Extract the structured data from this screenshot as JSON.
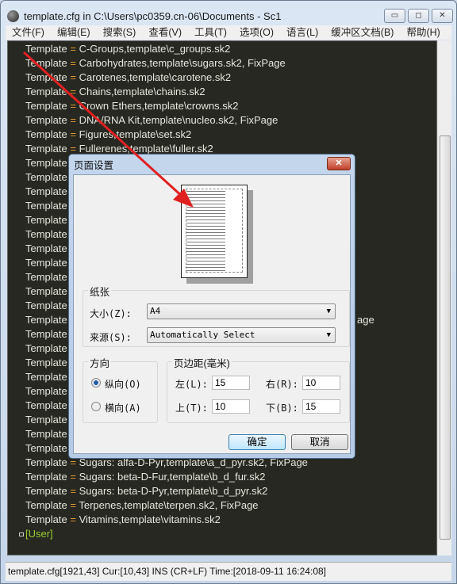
{
  "window": {
    "title": "template.cfg in C:\\Users\\pc0359.cn-06\\Documents - Sc1",
    "buttons": {
      "minimize": "▭",
      "maximize": "◻",
      "close": "✕"
    }
  },
  "menu": [
    "文件(F)",
    "编辑(E)",
    "搜索(S)",
    "查看(V)",
    "工具(T)",
    "选项(O)",
    "语言(L)",
    "缓冲区文档(B)",
    "帮助(H)"
  ],
  "editor": {
    "key": "Template",
    "eq": "=",
    "lines": [
      "C-Groups,template\\c_groups.sk2",
      "Carbohydrates,template\\sugars.sk2, FixPage",
      "Carotenes,template\\carotene.sk2",
      "Chains,template\\chains.sk2",
      "Crown Ethers,template\\crowns.sk2",
      "DNA/RNA Kit,template\\nucleo.sk2, FixPage",
      "Figures,template\\set.sk2",
      "Fullerenes,template\\fuller.sk2",
      "",
      "",
      "",
      "",
      "",
      "",
      "",
      "",
      "",
      "",
      "",
      "",
      "",
      "",
      "",
      "",
      "",
      "",
      "",
      "",
      "",
      "Sugars: alfa-D-Pyr,template\\a_d_pyr.sk2, FixPage",
      "Sugars: beta-D-Fur,template\\b_d_fur.sk2",
      "Sugars: beta-D-Pyr,template\\b_d_pyr.sk2",
      "Terpenes,template\\terpen.sk2, FixPage",
      "Vitamins,template\\vitamins.sk2"
    ],
    "partial_tail": "age",
    "section": "[User]"
  },
  "status": "template.cfg[1921,43] Cur:[10,43] INS (CR+LF)  Time:[2018-09-11 16:24:08]",
  "dialog": {
    "title": "页面设置",
    "close": "✕",
    "paper": {
      "label": "纸张",
      "size_label": "大小(Z):",
      "size_value": "A4",
      "source_label": "来源(S):",
      "source_value": "Automatically Select"
    },
    "orientation": {
      "label": "方向",
      "portrait": "纵向(O)",
      "landscape": "横向(A)",
      "selected": "portrait"
    },
    "margins": {
      "label": "页边距(毫米)",
      "left_label": "左(L):",
      "left": "15",
      "right_label": "右(R):",
      "right": "10",
      "top_label": "上(T):",
      "top": "10",
      "bottom_label": "下(B):",
      "bottom": "15"
    },
    "ok": "确定",
    "cancel": "取消"
  },
  "colors": {
    "editor_bg": "#272822",
    "operator": "#e09a2f",
    "section": "#9acd32",
    "annotation_arrow": "#e02020"
  }
}
